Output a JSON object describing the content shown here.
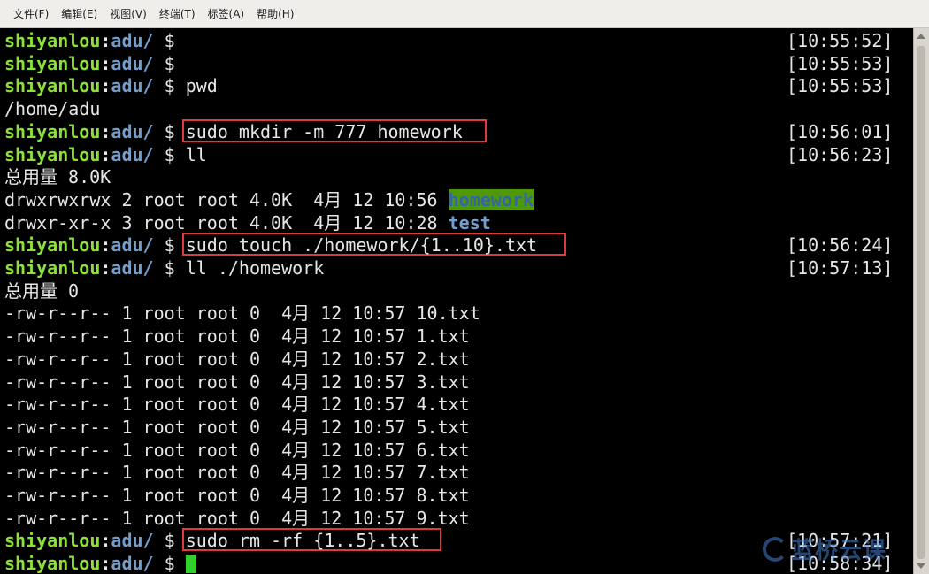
{
  "menu": [
    {
      "label": "文件(F)"
    },
    {
      "label": "编辑(E)"
    },
    {
      "label": "视图(V)"
    },
    {
      "label": "终端(T)"
    },
    {
      "label": "标签(A)"
    },
    {
      "label": "帮助(H)"
    }
  ],
  "prompt": {
    "host": "shiyanlou",
    "colon": ":",
    "path": "adu/",
    "symbol": " $ "
  },
  "lines": [
    {
      "cmd": "",
      "ts": "[10:55:52]"
    },
    {
      "cmd": "",
      "ts": "[10:55:53]"
    },
    {
      "cmd": "pwd",
      "ts": "[10:55:53]"
    },
    {
      "out": "/home/adu"
    },
    {
      "cmd": "sudo mkdir -m 777 homework",
      "ts": "[10:56:01]"
    },
    {
      "cmd": "ll",
      "ts": "[10:56:23]"
    },
    {
      "out": "总用量 8.0K"
    },
    {
      "out": "drwxrwxrwx 2 root root 4.0K  4月 12 10:56 ",
      "name": "homework"
    },
    {
      "out": "drwxr-xr-x 3 root root 4.0K  4月 12 10:28 ",
      "name": "test"
    },
    {
      "cmd": "sudo touch ./homework/{1..10}.txt",
      "ts": "[10:56:24]"
    },
    {
      "cmd": "ll ./homework",
      "ts": "[10:57:13]"
    },
    {
      "out": "总用量 0"
    },
    {
      "out": "-rw-r--r-- 1 root root 0  4月 12 10:57 10.txt"
    },
    {
      "out": "-rw-r--r-- 1 root root 0  4月 12 10:57 1.txt"
    },
    {
      "out": "-rw-r--r-- 1 root root 0  4月 12 10:57 2.txt"
    },
    {
      "out": "-rw-r--r-- 1 root root 0  4月 12 10:57 3.txt"
    },
    {
      "out": "-rw-r--r-- 1 root root 0  4月 12 10:57 4.txt"
    },
    {
      "out": "-rw-r--r-- 1 root root 0  4月 12 10:57 5.txt"
    },
    {
      "out": "-rw-r--r-- 1 root root 0  4月 12 10:57 6.txt"
    },
    {
      "out": "-rw-r--r-- 1 root root 0  4月 12 10:57 7.txt"
    },
    {
      "out": "-rw-r--r-- 1 root root 0  4月 12 10:57 8.txt"
    },
    {
      "out": "-rw-r--r-- 1 root root 0  4月 12 10:57 9.txt"
    },
    {
      "cmd": "sudo rm -rf {1..5}.txt",
      "ts": "[10:57:21]"
    },
    {
      "cmd": "",
      "ts": "[10:58:34]",
      "cursor": true
    }
  ],
  "watermark": "蓝桥云课",
  "colors": {
    "background": "#000000",
    "prompt_host": "#8ae234",
    "prompt_path": "#729fcf",
    "sticky_dir_bg": "#4e9a06",
    "cursor": "#2fd12a",
    "highlight_box": "#e0393d"
  },
  "highlighted_commands": [
    "sudo mkdir -m 777 homework",
    "sudo touch ./homework/{1..10}.txt",
    "sudo rm -rf {1..5}.txt"
  ]
}
